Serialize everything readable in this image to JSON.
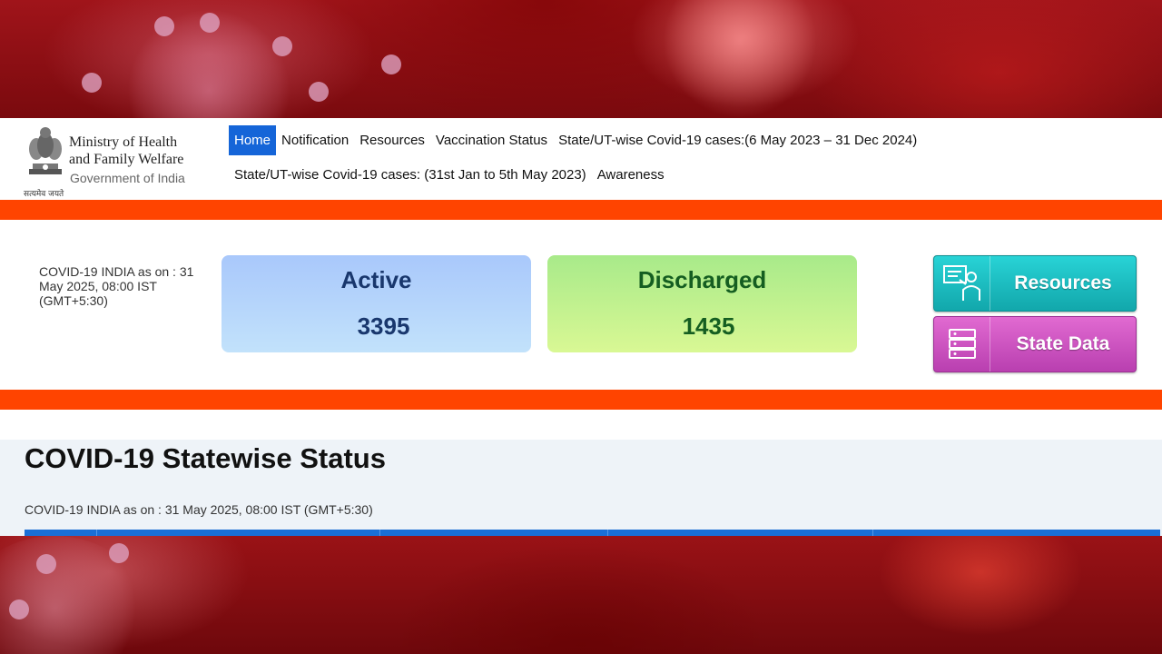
{
  "header": {
    "ministry_line1": "Ministry of Health",
    "ministry_line2": "and Family Welfare",
    "government": "Government of India",
    "motto": "सत्यमेव जयते"
  },
  "nav": {
    "row1": [
      "Home",
      "Notification",
      "Resources",
      "Vaccination Status",
      "State/UT-wise Covid-19 cases:(6 May 2023 – 31 Dec 2024)"
    ],
    "row2": [
      "State/UT-wise Covid-19 cases: (31st Jan to 5th May 2023)",
      "Awareness"
    ],
    "active": "Home"
  },
  "stats": {
    "as_of": "COVID-19 INDIA as on : 31 May 2025, 08:00 IST (GMT+5:30)",
    "active_label": "Active",
    "active_value": "3395",
    "discharged_label": "Discharged",
    "discharged_value": "1435"
  },
  "side_buttons": {
    "resources": "Resources",
    "state_data": "State Data"
  },
  "statewise": {
    "title": "COVID-19 Statewise Status",
    "subtitle": "COVID-19 INDIA as on : 31 May 2025, 08:00 IST (GMT+5:30)"
  },
  "colors": {
    "nav_active": "#1565d8",
    "orange_bar": "#ff4400",
    "active_card": "#a9c8fb",
    "discharged_card": "#a8ea8a",
    "resources_button": "#1cbcc0",
    "state_data_button": "#cc52c0",
    "table_header": "#1a6fd6"
  },
  "icons": {
    "emblem": "national-emblem-icon",
    "resources": "presenter-icon",
    "state_data": "server-database-icon"
  }
}
